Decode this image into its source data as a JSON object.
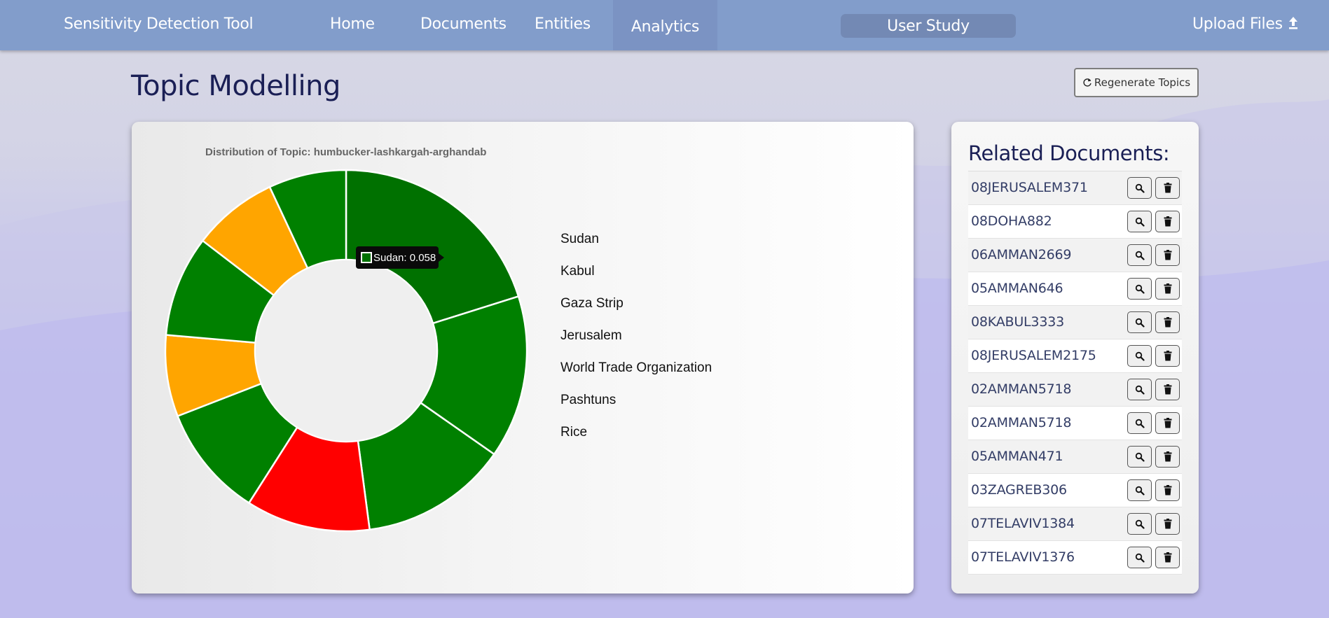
{
  "navbar": {
    "brand": "Sensitivity Detection Tool",
    "links": [
      "Home",
      "Documents",
      "Entities"
    ],
    "active": "Analytics",
    "study": "User Study",
    "upload": "Upload Files"
  },
  "page": {
    "title": "Topic Modelling",
    "regenerate_label": "Regenerate Topics"
  },
  "chart_data": {
    "type": "pie",
    "title": "Distribution of Topic: humbucker-lashkargah-arghandab",
    "tooltip": "Sudan: 0.058",
    "categories": [
      "Sudan",
      "Kabul",
      "Gaza Strip",
      "Jerusalem",
      "World Trade Organization",
      "Pashtuns",
      "Rice",
      "",
      ""
    ],
    "values": [
      0.058,
      0.042,
      0.038,
      0.032,
      0.029,
      0.021,
      0.026,
      0.022,
      0.02
    ],
    "colors": [
      "#007100",
      "#008000",
      "#008000",
      "#ff0000",
      "#008000",
      "#ffa500",
      "#008000",
      "#ffa500",
      "#008000"
    ],
    "legend": [
      "Sudan",
      "Kabul",
      "Gaza Strip",
      "Jerusalem",
      "World Trade Organization",
      "Pashtuns",
      "Rice"
    ],
    "legend_position": "right"
  },
  "related": {
    "title": "Related Documents:",
    "documents": [
      "08JERUSALEM371",
      "08DOHA882",
      "06AMMAN2669",
      "05AMMAN646",
      "08KABUL3333",
      "08JERUSALEM2175",
      "02AMMAN5718",
      "02AMMAN5718",
      "05AMMAN471",
      "03ZAGREB306",
      "07TELAVIV1384",
      "07TELAVIV1376"
    ]
  },
  "icons": [
    "refresh-icon",
    "upload-icon",
    "search-icon",
    "trash-icon"
  ]
}
